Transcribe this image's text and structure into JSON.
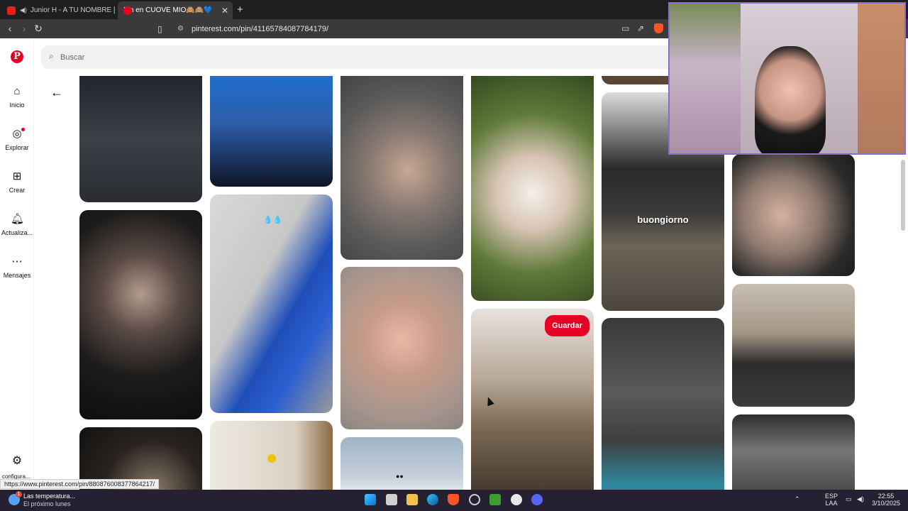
{
  "browser": {
    "tabs": [
      {
        "title": "Junior H - A TU NOMBRE [Officia",
        "kind": "youtube"
      },
      {
        "title": "Pin en CUOVE MIO🙈🙈💙",
        "kind": "pinterest",
        "active": true
      }
    ],
    "url": "pinterest.com/pin/411657840877841​79/",
    "new_tab": "+",
    "close_tab": "✕"
  },
  "rail": {
    "logo": "P",
    "items": [
      {
        "label": "Inicio",
        "icon": "home-icon",
        "glyph": "⌂"
      },
      {
        "label": "Explorar",
        "icon": "compass-icon",
        "glyph": "◎"
      },
      {
        "label": "Crear",
        "icon": "plus-square-icon",
        "glyph": "⊞"
      },
      {
        "label": "Actualiza...",
        "icon": "bell-icon",
        "glyph": "♫"
      },
      {
        "label": "Mensajes",
        "icon": "chat-bubble-icon",
        "glyph": "⋯"
      }
    ],
    "settings_label": "configura..."
  },
  "search": {
    "placeholder": "Buscar"
  },
  "feed": {
    "overlay_buongiorno": "buongiorno",
    "save_label": "Guardar",
    "drops": "💧💧"
  },
  "status_url": "https://www.pinterest.com/pin/880876008377864217/",
  "taskbar": {
    "weather_title": "Las temperatura...",
    "weather_sub": "El próximo lunes",
    "weather_badge": "1",
    "lang_top": "ESP",
    "lang_bottom": "LAA",
    "time": "22:55",
    "date": "3/10/2025"
  },
  "colors": {
    "brand": "#e60023",
    "chrome_dark": "#1f1f1f",
    "taskbar": "#262033"
  }
}
